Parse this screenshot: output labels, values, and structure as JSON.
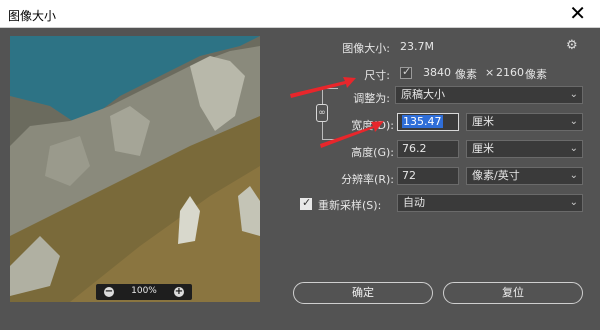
{
  "window": {
    "title": "图像大小"
  },
  "preview": {
    "zoom": "100%"
  },
  "info": {
    "image_size_label": "图像大小:",
    "image_size_value": "23.7M",
    "dimensions_label": "尺寸:",
    "width_px": "3840",
    "unit_px": "像素",
    "times": "×",
    "height_px": "2160",
    "unit_px_2": "像素"
  },
  "fit_to": {
    "label": "调整为:",
    "value": "原稿大小"
  },
  "width": {
    "label": "宽度(D):",
    "value": "135.47",
    "unit": "厘米"
  },
  "height": {
    "label": "高度(G):",
    "value": "76.2",
    "unit": "厘米"
  },
  "resolution": {
    "label": "分辨率(R):",
    "value": "72",
    "unit": "像素/英寸"
  },
  "resample": {
    "label": "重新采样(S):",
    "value": "自动",
    "checked": true
  },
  "buttons": {
    "ok": "确定",
    "reset": "复位"
  },
  "colors": {
    "accent_arrow": "#e8262b",
    "dialog_bg": "#535353",
    "selection": "#2f6ed8"
  }
}
